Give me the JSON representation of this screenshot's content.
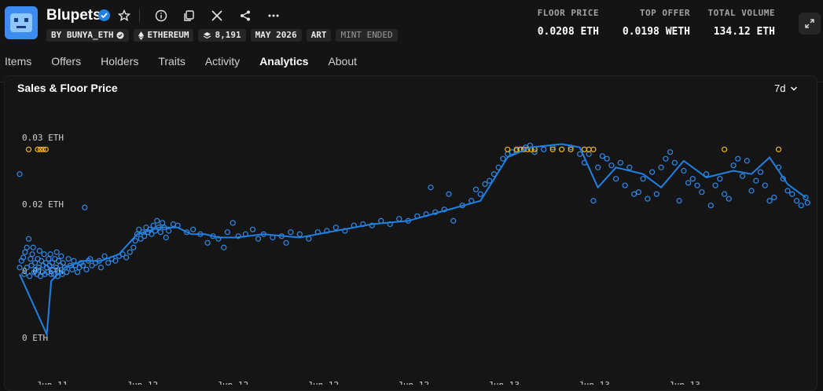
{
  "header": {
    "title": "Blupets",
    "tags": [
      {
        "label": "BY BUNYA_ETH",
        "icon": "verified-icon"
      },
      {
        "label": "ETHEREUM",
        "icon": "ethereum-icon"
      },
      {
        "label": "8,191",
        "icon": "layers-icon"
      },
      {
        "label": "MAY 2026"
      },
      {
        "label": "ART"
      },
      {
        "label": "MINT ENDED"
      }
    ],
    "stats": {
      "floor_price": {
        "label": "FLOOR PRICE",
        "value": "0.0208 ETH"
      },
      "top_offer": {
        "label": "TOP OFFER",
        "value": "0.0198 WETH"
      },
      "total_volume": {
        "label": "TOTAL VOLUME",
        "value": "134.12 ETH"
      }
    }
  },
  "tabs": [
    "Items",
    "Offers",
    "Holders",
    "Traits",
    "Activity",
    "Analytics",
    "About"
  ],
  "active_tab": "Analytics",
  "panel": {
    "title": "Sales & Floor Price",
    "range": "7d"
  },
  "colors": {
    "accent": "#2081e2",
    "sale_dot": "#2f8cf0",
    "outlier_dot": "#f2b90f",
    "background": "#111111"
  },
  "chart_data": {
    "type": "scatter",
    "ylim": [
      0,
      0.03
    ],
    "y_ticks": [
      {
        "value": 0.03,
        "label": "0.03 ETH"
      },
      {
        "value": 0.02,
        "label": "0.02 ETH"
      },
      {
        "value": 0.01,
        "label": "0.01 ETH"
      },
      {
        "value": 0,
        "label": "0 ETH"
      }
    ],
    "x_range": [
      0,
      8
    ],
    "x_ticks": [
      {
        "value": 0.36,
        "label": "Jun 11"
      },
      {
        "value": 1.36,
        "label": "Jun 12"
      },
      {
        "value": 2.36,
        "label": "Jun 12"
      },
      {
        "value": 3.36,
        "label": "Jun 12"
      },
      {
        "value": 4.36,
        "label": "Jun 12"
      },
      {
        "value": 5.36,
        "label": "Jun 13"
      },
      {
        "value": 6.36,
        "label": "Jun 13"
      },
      {
        "value": 7.36,
        "label": "Jun 13"
      }
    ],
    "series": [
      {
        "role": "floor-line",
        "points": [
          [
            0.0,
            0.0095
          ],
          [
            0.3,
            0.0005
          ],
          [
            0.35,
            0.0085
          ],
          [
            0.5,
            0.0105
          ],
          [
            0.7,
            0.0115
          ],
          [
            0.9,
            0.0115
          ],
          [
            1.1,
            0.0125
          ],
          [
            1.3,
            0.0155
          ],
          [
            1.55,
            0.0165
          ],
          [
            1.75,
            0.0165
          ],
          [
            1.9,
            0.0155
          ],
          [
            2.05,
            0.0155
          ],
          [
            2.2,
            0.015
          ],
          [
            2.4,
            0.015
          ],
          [
            2.7,
            0.0155
          ],
          [
            3.1,
            0.015
          ],
          [
            3.5,
            0.016
          ],
          [
            3.9,
            0.017
          ],
          [
            4.3,
            0.0175
          ],
          [
            4.7,
            0.019
          ],
          [
            5.1,
            0.0205
          ],
          [
            5.4,
            0.027
          ],
          [
            5.65,
            0.0285
          ],
          [
            6.0,
            0.029
          ],
          [
            6.2,
            0.0285
          ],
          [
            6.3,
            0.0255
          ],
          [
            6.4,
            0.0225
          ],
          [
            6.6,
            0.0255
          ],
          [
            6.9,
            0.0245
          ],
          [
            7.1,
            0.0225
          ],
          [
            7.35,
            0.0265
          ],
          [
            7.6,
            0.024
          ],
          [
            7.9,
            0.025
          ],
          [
            8.1,
            0.0245
          ],
          [
            8.3,
            0.027
          ],
          [
            8.5,
            0.023
          ],
          [
            8.7,
            0.021
          ]
        ]
      },
      {
        "role": "sales",
        "points": [
          [
            0.0,
            0.0245
          ],
          [
            0.0,
            0.0105
          ],
          [
            0.02,
            0.0115
          ],
          [
            0.04,
            0.012
          ],
          [
            0.05,
            0.0095
          ],
          [
            0.06,
            0.0128
          ],
          [
            0.08,
            0.0135
          ],
          [
            0.08,
            0.0105
          ],
          [
            0.1,
            0.0148
          ],
          [
            0.11,
            0.0092
          ],
          [
            0.12,
            0.0118
          ],
          [
            0.13,
            0.0108
          ],
          [
            0.14,
            0.0125
          ],
          [
            0.15,
            0.0135
          ],
          [
            0.16,
            0.0098
          ],
          [
            0.17,
            0.0112
          ],
          [
            0.18,
            0.0102
          ],
          [
            0.19,
            0.0095
          ],
          [
            0.2,
            0.0118
          ],
          [
            0.21,
            0.0105
          ],
          [
            0.22,
            0.013
          ],
          [
            0.23,
            0.0092
          ],
          [
            0.24,
            0.0115
          ],
          [
            0.25,
            0.0098
          ],
          [
            0.26,
            0.0108
          ],
          [
            0.27,
            0.0125
          ],
          [
            0.28,
            0.0095
          ],
          [
            0.29,
            0.0112
          ],
          [
            0.3,
            0.0105
          ],
          [
            0.31,
            0.0098
          ],
          [
            0.32,
            0.0118
          ],
          [
            0.33,
            0.0108
          ],
          [
            0.34,
            0.0125
          ],
          [
            0.35,
            0.0095
          ],
          [
            0.36,
            0.0112
          ],
          [
            0.37,
            0.0102
          ],
          [
            0.38,
            0.0095
          ],
          [
            0.39,
            0.0118
          ],
          [
            0.4,
            0.0105
          ],
          [
            0.41,
            0.0128
          ],
          [
            0.42,
            0.0092
          ],
          [
            0.43,
            0.0115
          ],
          [
            0.44,
            0.0098
          ],
          [
            0.45,
            0.0108
          ],
          [
            0.46,
            0.0122
          ],
          [
            0.47,
            0.0095
          ],
          [
            0.48,
            0.0112
          ],
          [
            0.5,
            0.0105
          ],
          [
            0.52,
            0.0098
          ],
          [
            0.54,
            0.0118
          ],
          [
            0.56,
            0.0108
          ],
          [
            0.58,
            0.0102
          ],
          [
            0.6,
            0.0115
          ],
          [
            0.62,
            0.0108
          ],
          [
            0.64,
            0.0098
          ],
          [
            0.66,
            0.0105
          ],
          [
            0.68,
            0.0112
          ],
          [
            0.7,
            0.0108
          ],
          [
            0.72,
            0.0195
          ],
          [
            0.74,
            0.0102
          ],
          [
            0.76,
            0.0115
          ],
          [
            0.78,
            0.0118
          ],
          [
            0.8,
            0.0108
          ],
          [
            0.84,
            0.0112
          ],
          [
            0.88,
            0.0115
          ],
          [
            0.9,
            0.0105
          ],
          [
            0.94,
            0.0122
          ],
          [
            0.98,
            0.0112
          ],
          [
            1.02,
            0.0118
          ],
          [
            1.06,
            0.0115
          ],
          [
            1.1,
            0.0122
          ],
          [
            1.14,
            0.0125
          ],
          [
            1.18,
            0.012
          ],
          [
            1.22,
            0.0128
          ],
          [
            1.26,
            0.0135
          ],
          [
            1.28,
            0.0145
          ],
          [
            1.3,
            0.0155
          ],
          [
            1.32,
            0.0162
          ],
          [
            1.34,
            0.0148
          ],
          [
            1.36,
            0.0158
          ],
          [
            1.38,
            0.0152
          ],
          [
            1.4,
            0.0165
          ],
          [
            1.42,
            0.0158
          ],
          [
            1.44,
            0.0162
          ],
          [
            1.46,
            0.0155
          ],
          [
            1.48,
            0.0168
          ],
          [
            1.5,
            0.016
          ],
          [
            1.52,
            0.0175
          ],
          [
            1.54,
            0.0165
          ],
          [
            1.56,
            0.0158
          ],
          [
            1.58,
            0.0172
          ],
          [
            1.6,
            0.0165
          ],
          [
            1.62,
            0.015
          ],
          [
            1.65,
            0.016
          ],
          [
            1.7,
            0.017
          ],
          [
            1.75,
            0.0168
          ],
          [
            1.85,
            0.0158
          ],
          [
            1.92,
            0.0162
          ],
          [
            2.0,
            0.0155
          ],
          [
            2.08,
            0.0142
          ],
          [
            2.14,
            0.0152
          ],
          [
            2.2,
            0.0148
          ],
          [
            2.26,
            0.0135
          ],
          [
            2.3,
            0.0158
          ],
          [
            2.36,
            0.0172
          ],
          [
            2.42,
            0.0152
          ],
          [
            2.5,
            0.0155
          ],
          [
            2.58,
            0.0162
          ],
          [
            2.64,
            0.0148
          ],
          [
            2.7,
            0.0155
          ],
          [
            2.8,
            0.015
          ],
          [
            2.9,
            0.0152
          ],
          [
            2.95,
            0.0142
          ],
          [
            3.0,
            0.0158
          ],
          [
            3.1,
            0.0155
          ],
          [
            3.2,
            0.0148
          ],
          [
            3.3,
            0.0158
          ],
          [
            3.4,
            0.016
          ],
          [
            3.5,
            0.0165
          ],
          [
            3.6,
            0.016
          ],
          [
            3.7,
            0.0168
          ],
          [
            3.8,
            0.017
          ],
          [
            3.9,
            0.0168
          ],
          [
            4.0,
            0.0175
          ],
          [
            4.1,
            0.017
          ],
          [
            4.2,
            0.0178
          ],
          [
            4.3,
            0.0175
          ],
          [
            4.4,
            0.0182
          ],
          [
            4.5,
            0.0185
          ],
          [
            4.55,
            0.0225
          ],
          [
            4.6,
            0.0188
          ],
          [
            4.7,
            0.0192
          ],
          [
            4.75,
            0.0215
          ],
          [
            4.8,
            0.0175
          ],
          [
            4.9,
            0.0198
          ],
          [
            5.0,
            0.0205
          ],
          [
            5.05,
            0.0222
          ],
          [
            5.1,
            0.0215
          ],
          [
            5.15,
            0.023
          ],
          [
            5.2,
            0.0235
          ],
          [
            5.25,
            0.0245
          ],
          [
            5.3,
            0.0255
          ],
          [
            5.35,
            0.0268
          ],
          [
            5.4,
            0.0275
          ],
          [
            5.45,
            0.0278
          ],
          [
            5.5,
            0.028
          ],
          [
            5.55,
            0.0282
          ],
          [
            5.6,
            0.0285
          ],
          [
            5.65,
            0.0288
          ],
          [
            5.7,
            0.0278
          ],
          [
            5.8,
            0.0282
          ],
          [
            5.9,
            0.0285
          ],
          [
            6.0,
            0.0282
          ],
          [
            6.1,
            0.0285
          ],
          [
            6.2,
            0.0275
          ],
          [
            6.25,
            0.0262
          ],
          [
            6.3,
            0.0275
          ],
          [
            6.35,
            0.0205
          ],
          [
            6.4,
            0.0255
          ],
          [
            6.45,
            0.0272
          ],
          [
            6.5,
            0.0268
          ],
          [
            6.55,
            0.0258
          ],
          [
            6.6,
            0.0238
          ],
          [
            6.65,
            0.0262
          ],
          [
            6.7,
            0.0228
          ],
          [
            6.75,
            0.0255
          ],
          [
            6.8,
            0.0215
          ],
          [
            6.85,
            0.0218
          ],
          [
            6.9,
            0.0238
          ],
          [
            6.95,
            0.0208
          ],
          [
            7.0,
            0.0248
          ],
          [
            7.05,
            0.0215
          ],
          [
            7.1,
            0.0255
          ],
          [
            7.15,
            0.0268
          ],
          [
            7.2,
            0.0278
          ],
          [
            7.25,
            0.0262
          ],
          [
            7.3,
            0.0205
          ],
          [
            7.35,
            0.025
          ],
          [
            7.4,
            0.0232
          ],
          [
            7.45,
            0.0238
          ],
          [
            7.5,
            0.0228
          ],
          [
            7.55,
            0.0218
          ],
          [
            7.6,
            0.0245
          ],
          [
            7.65,
            0.0198
          ],
          [
            7.7,
            0.0228
          ],
          [
            7.75,
            0.0238
          ],
          [
            7.8,
            0.0215
          ],
          [
            7.85,
            0.0208
          ],
          [
            7.9,
            0.0258
          ],
          [
            7.95,
            0.0268
          ],
          [
            8.0,
            0.0242
          ],
          [
            8.05,
            0.0265
          ],
          [
            8.1,
            0.022
          ],
          [
            8.15,
            0.0235
          ],
          [
            8.2,
            0.0248
          ],
          [
            8.25,
            0.0228
          ],
          [
            8.3,
            0.0205
          ],
          [
            8.35,
            0.021
          ],
          [
            8.4,
            0.0255
          ],
          [
            8.45,
            0.0238
          ],
          [
            8.5,
            0.022
          ],
          [
            8.55,
            0.0215
          ],
          [
            8.6,
            0.0205
          ],
          [
            8.65,
            0.0198
          ],
          [
            8.7,
            0.021
          ],
          [
            8.72,
            0.0202
          ]
        ]
      },
      {
        "role": "sales-outlier",
        "points": [
          [
            0.1,
            0.0282
          ],
          [
            0.2,
            0.0282
          ],
          [
            0.23,
            0.0282
          ],
          [
            0.26,
            0.0282
          ],
          [
            0.29,
            0.0282
          ],
          [
            5.4,
            0.0282
          ],
          [
            5.5,
            0.0282
          ],
          [
            5.54,
            0.0282
          ],
          [
            5.58,
            0.0282
          ],
          [
            5.62,
            0.0282
          ],
          [
            5.66,
            0.0282
          ],
          [
            5.7,
            0.0282
          ],
          [
            5.9,
            0.0282
          ],
          [
            6.0,
            0.0282
          ],
          [
            6.1,
            0.0282
          ],
          [
            6.25,
            0.0282
          ],
          [
            6.3,
            0.0282
          ],
          [
            6.35,
            0.0282
          ],
          [
            7.8,
            0.0282
          ],
          [
            8.4,
            0.0282
          ]
        ]
      }
    ]
  }
}
